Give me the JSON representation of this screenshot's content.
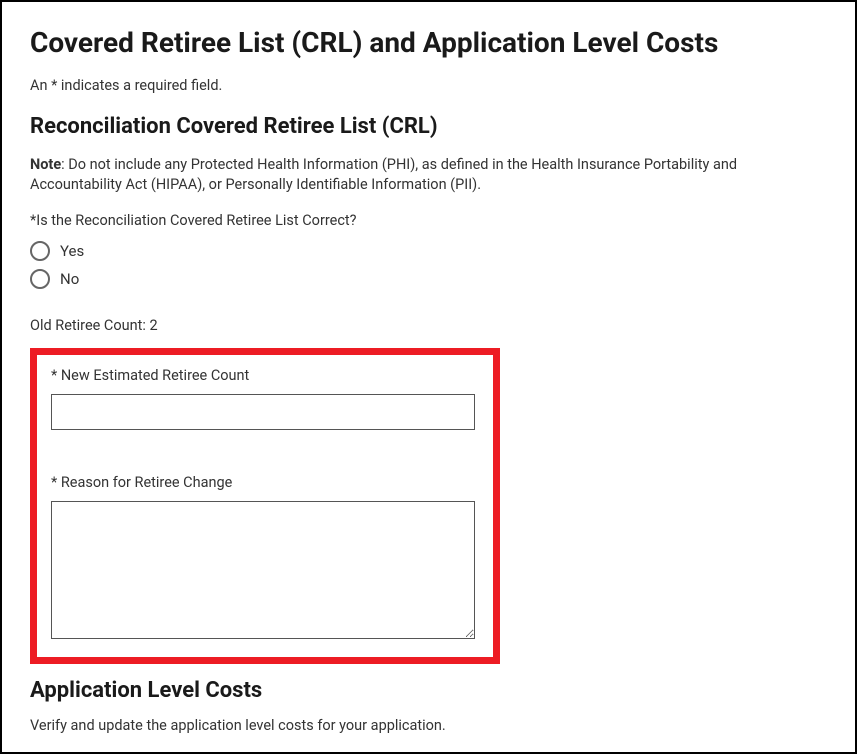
{
  "header": {
    "title": "Covered Retiree List (CRL) and Application Level Costs",
    "required_note": "An * indicates a required field."
  },
  "reconciliation": {
    "heading": "Reconciliation Covered Retiree List (CRL)",
    "note_bold": "Note",
    "note_text": ": Do not include any Protected Health Information (PHI), as defined in the Health Insurance Portability and Accountability Act (HIPAA), or Personally Identifiable Information (PII).",
    "question": "*Is the Reconciliation Covered Retiree List Correct?",
    "options": {
      "yes": "Yes",
      "no": "No"
    },
    "old_count_label": "Old Retiree Count: 2",
    "new_count_label": "* New Estimated Retiree Count",
    "reason_label": "* Reason for Retiree Change"
  },
  "application_costs": {
    "heading": "Application Level Costs",
    "verify_text": "Verify and update the application level costs for your application."
  }
}
